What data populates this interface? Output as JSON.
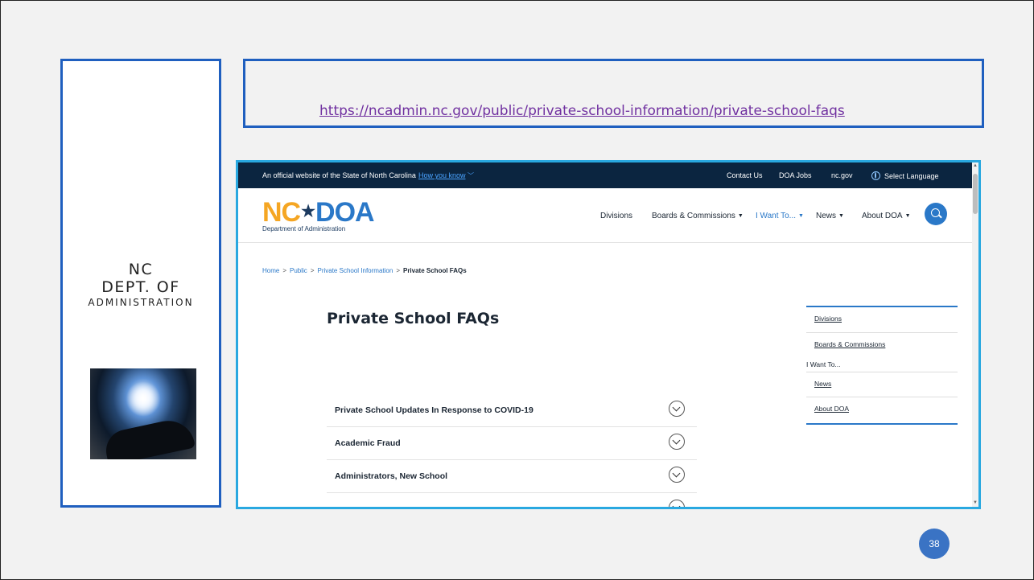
{
  "slide": {
    "org": {
      "line1": "NC",
      "line2": "DEPT. OF",
      "line3": "ADMINISTRATION"
    },
    "url": "https://ncadmin.nc.gov/public/private-school-information/private-school-faqs",
    "page_number": "38"
  },
  "site": {
    "topbar": {
      "official": "An official website of the State of North Carolina",
      "how_you_know": "How you know",
      "links": [
        "Contact Us",
        "DOA Jobs",
        "nc.gov"
      ],
      "language": "Select Language"
    },
    "logo": {
      "nc": "NC",
      "doa": "DOA",
      "subtitle": "Department of Administration"
    },
    "nav": [
      "Divisions",
      "Boards & Commissions",
      "I Want To...",
      "News",
      "About DOA"
    ],
    "breadcrumb": [
      "Home",
      "Public",
      "Private School Information",
      "Private School FAQs"
    ],
    "title": "Private School FAQs",
    "faqs": [
      "Private School Updates In Response to COVID-19",
      "Academic Fraud",
      "Administrators, New School"
    ],
    "side_menu": [
      "Divisions",
      "Boards & Commissions",
      "I Want To...",
      "News",
      "About DOA"
    ],
    "colors": {
      "topbar": "#0b2540",
      "accent": "#2a78c8",
      "logo_nc": "#f5a623",
      "slide_border": "#1f5fbf",
      "browser_border": "#29a8e0"
    }
  }
}
